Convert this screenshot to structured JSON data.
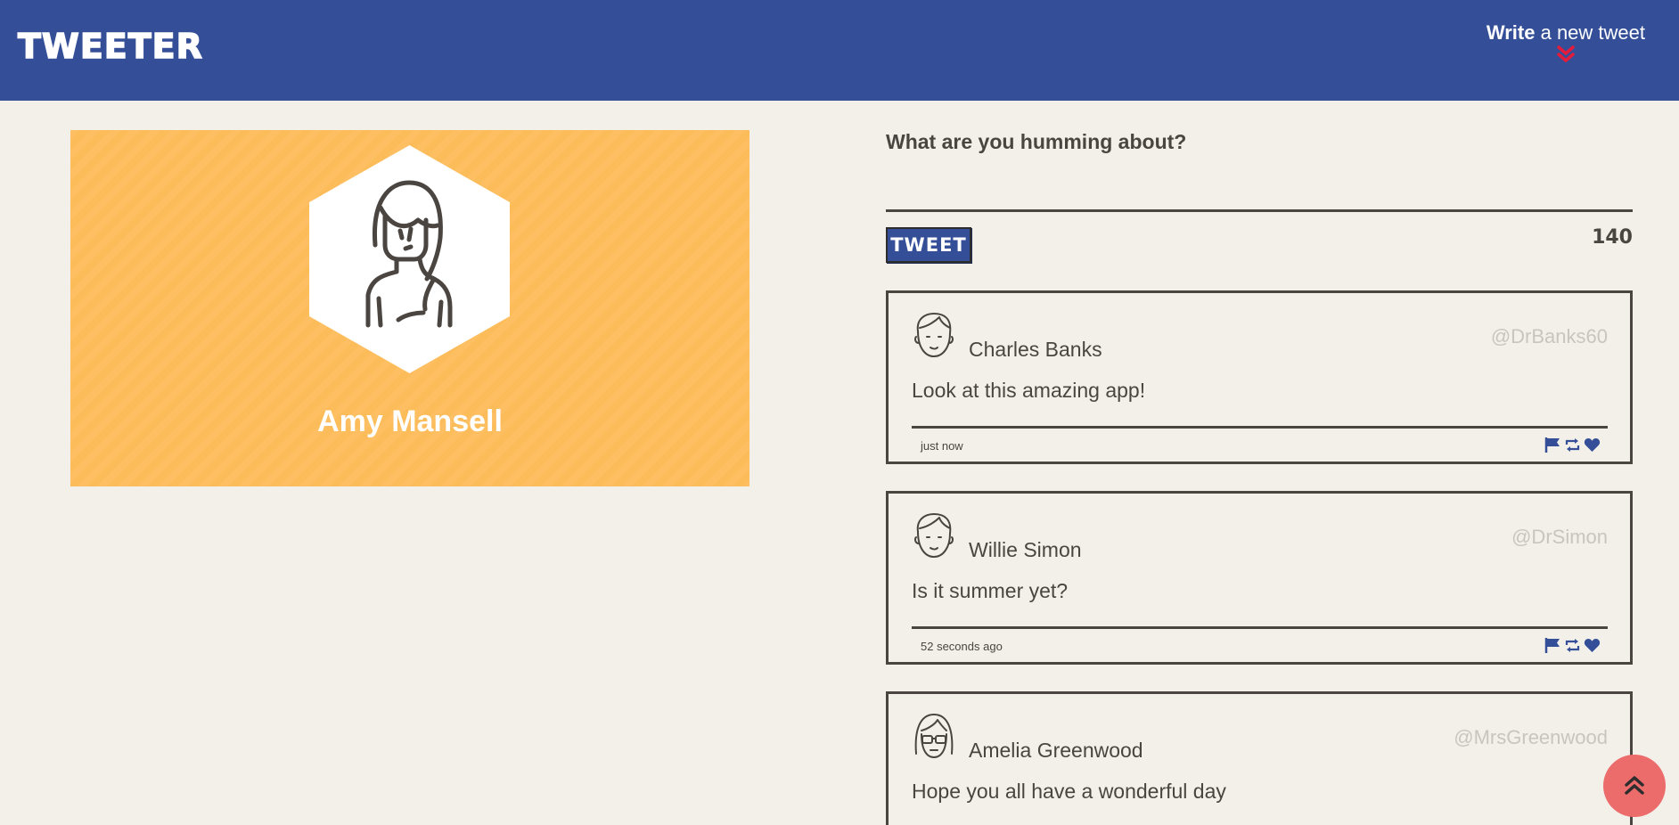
{
  "navbar": {
    "brand": "TWEETER",
    "compose_toggle": {
      "strong": "Write",
      "rest": " a new tweet",
      "icon": "double-chevron-down-icon",
      "icon_color": "#e31b3d"
    },
    "background": "#344f98"
  },
  "profile": {
    "name": "Amy Mansell",
    "avatar_icon": "female-user-icon",
    "card_color": "#fdbc5a"
  },
  "composer": {
    "prompt": "What are you humming about?",
    "placeholder": "",
    "submit_label": "TWEET",
    "char_counter": "140"
  },
  "tweets": [
    {
      "author": "Charles Banks",
      "handle": "@DrBanks60",
      "content": "Look at this amazing app!",
      "time": "just now",
      "avatar_icon": "male-user-icon"
    },
    {
      "author": "Willie Simon",
      "handle": "@DrSimon",
      "content": "Is it summer yet?",
      "time": "52 seconds ago",
      "avatar_icon": "male-user-icon"
    },
    {
      "author": "Amelia Greenwood",
      "handle": "@MrsGreenwood",
      "content": "Hope you all have a wonderful day",
      "time": "",
      "avatar_icon": "female-glasses-user-icon"
    }
  ],
  "tweet_actions": [
    "flag-icon",
    "retweet-icon",
    "heart-icon"
  ],
  "scroll_top": {
    "icon": "double-chevron-up-icon",
    "color": "#ec6b6b"
  }
}
